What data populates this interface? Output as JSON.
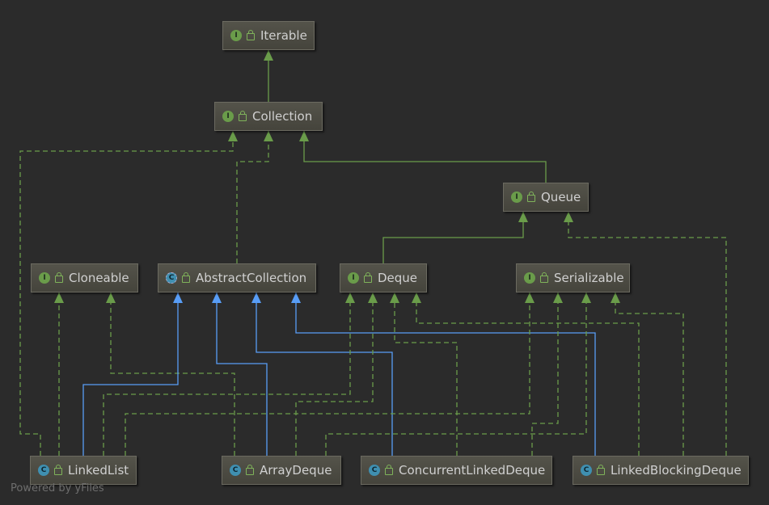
{
  "nodes": {
    "iterable": {
      "kind": "I",
      "label": "Iterable"
    },
    "collection": {
      "kind": "I",
      "label": "Collection"
    },
    "queue": {
      "kind": "I",
      "label": "Queue"
    },
    "cloneable": {
      "kind": "I",
      "label": "Cloneable"
    },
    "abstractcollection": {
      "kind": "C",
      "label": "AbstractCollection"
    },
    "deque": {
      "kind": "I",
      "label": "Deque"
    },
    "serializable": {
      "kind": "I",
      "label": "Serializable"
    },
    "linkedlist": {
      "kind": "C",
      "label": "LinkedList"
    },
    "arraydeque": {
      "kind": "C",
      "label": "ArrayDeque"
    },
    "concurrentlinkeddeque": {
      "kind": "C",
      "label": "ConcurrentLinkedDeque"
    },
    "linkedblockingdeque": {
      "kind": "C",
      "label": "LinkedBlockingDeque"
    }
  },
  "edges": [
    {
      "from": "collection",
      "to": "iterable",
      "type": "extends"
    },
    {
      "from": "queue",
      "to": "collection",
      "type": "extends"
    },
    {
      "from": "deque",
      "to": "queue",
      "type": "extends"
    },
    {
      "from": "abstractcollection",
      "to": "collection",
      "type": "implements"
    },
    {
      "from": "linkedlist",
      "to": "collection",
      "type": "implements"
    },
    {
      "from": "linkedblockingdeque",
      "to": "queue",
      "type": "implements"
    },
    {
      "from": "linkedlist",
      "to": "cloneable",
      "type": "implements"
    },
    {
      "from": "arraydeque",
      "to": "cloneable",
      "type": "implements"
    },
    {
      "from": "linkedlist",
      "to": "abstractcollection",
      "type": "class-extends"
    },
    {
      "from": "arraydeque",
      "to": "abstractcollection",
      "type": "class-extends"
    },
    {
      "from": "concurrentlinkeddeque",
      "to": "abstractcollection",
      "type": "class-extends"
    },
    {
      "from": "linkedblockingdeque",
      "to": "abstractcollection",
      "type": "class-extends"
    },
    {
      "from": "linkedlist",
      "to": "deque",
      "type": "implements"
    },
    {
      "from": "arraydeque",
      "to": "deque",
      "type": "implements"
    },
    {
      "from": "concurrentlinkeddeque",
      "to": "deque",
      "type": "implements"
    },
    {
      "from": "linkedblockingdeque",
      "to": "deque",
      "type": "implements"
    },
    {
      "from": "linkedlist",
      "to": "serializable",
      "type": "implements"
    },
    {
      "from": "concurrentlinkeddeque",
      "to": "serializable",
      "type": "implements"
    },
    {
      "from": "arraydeque",
      "to": "serializable",
      "type": "implements"
    },
    {
      "from": "linkedblockingdeque",
      "to": "serializable",
      "type": "implements"
    }
  ],
  "colors": {
    "extends": "#6a9c4a",
    "implements": "#6a9c4a",
    "class-extends": "#589df6"
  },
  "watermark": "Powered by yFiles"
}
